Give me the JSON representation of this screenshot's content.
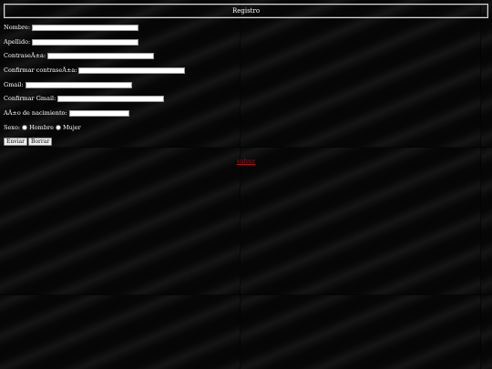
{
  "header": {
    "title": "Registro"
  },
  "form": {
    "fields": [
      {
        "label": "Nombre:",
        "value": "",
        "width": 117
      },
      {
        "label": "Apellido:",
        "value": "",
        "width": 117
      },
      {
        "label": "ContraseÃ±a:",
        "value": "",
        "width": 117
      },
      {
        "label": "Confirmar contraseÃ±a:",
        "value": "",
        "width": 117
      },
      {
        "label": "Gmail:",
        "value": "",
        "width": 117
      },
      {
        "label": "Confirmar Gmail:",
        "value": "",
        "width": 117
      },
      {
        "label": "AÃ±o de nacimiento:",
        "value": "",
        "width": 66
      }
    ],
    "sexo": {
      "label": "Sexo:",
      "options": [
        "Hombre",
        "Mujer"
      ]
    },
    "buttons": {
      "submit": "Enviar",
      "reset": "Borrar"
    }
  },
  "footer": {
    "link": "volver"
  }
}
